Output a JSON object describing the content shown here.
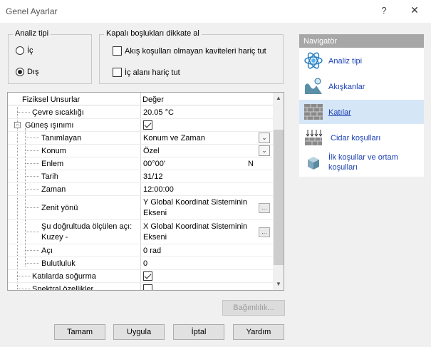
{
  "window": {
    "title": "Genel Ayarlar",
    "help_glyph": "?",
    "close_glyph": "✕"
  },
  "analysis": {
    "legend": "Analiz tipi",
    "options": [
      {
        "label": "İç",
        "selected": false
      },
      {
        "label": "Dış",
        "selected": true
      }
    ]
  },
  "cavities": {
    "legend": "Kapalı boşlukları dikkate al",
    "options": [
      {
        "label": "Akış koşulları olmayan kaviteleri hariç tut",
        "checked": false
      },
      {
        "label": "İç alanı hariç tut",
        "checked": false
      }
    ]
  },
  "grid": {
    "headers": {
      "name": "Fiziksel Unsurlar",
      "value": "Değer"
    },
    "rows": [
      {
        "label": "Çevre sıcaklığı",
        "value": "20.05 °C"
      },
      {
        "label": "Güneş ışınımı",
        "value": "",
        "checked": true
      },
      {
        "label": "Tanımlayan",
        "value": "Konum ve Zaman"
      },
      {
        "label": "Konum",
        "value": "Özel"
      },
      {
        "label": "Enlem",
        "value": "00°00'",
        "suffix": "N"
      },
      {
        "label": "Tarih",
        "value": "31/12"
      },
      {
        "label": "Zaman",
        "value": "12:00:00"
      },
      {
        "label": "Zenit yönü",
        "value_line1": "Y  Global Koordinat Sisteminin",
        "value_line2": "Ekseni"
      },
      {
        "label_line1": "Şu doğrultuda ölçülen açı:",
        "label_line2": "Kuzey -",
        "value_line1": "X  Global Koordinat Sisteminin",
        "value_line2": "Ekseni"
      },
      {
        "label": "Açı",
        "value": "0 rad"
      },
      {
        "label": "Bulutluluk",
        "value": "0"
      },
      {
        "label": "Katılarda soğurma",
        "value": "",
        "checked": true
      },
      {
        "label": "Spektral özellikler",
        "value": "",
        "checked": false
      }
    ],
    "ellipsis": "...",
    "combo_arrow": "⌄",
    "tree_toggle": "−"
  },
  "navigator": {
    "title": "Navigatör",
    "items": [
      {
        "label": "Analiz tipi",
        "icon": "atom-icon"
      },
      {
        "label": "Akışkanlar",
        "icon": "fluid-icon"
      },
      {
        "label": "Katılar",
        "icon": "brick-wall-icon",
        "selected": true
      },
      {
        "label": "Cidar koşulları",
        "icon": "wall-condition-icon"
      },
      {
        "label_line1": "İlk koşullar ve ortam",
        "label_line2": "koşulları",
        "icon": "cube-icon"
      }
    ]
  },
  "buttons": {
    "dependency": "Bağımlılık...",
    "ok": "Tamam",
    "apply": "Uygula",
    "cancel": "İptal",
    "help": "Yardım"
  },
  "colors": {
    "link": "#1a3fb3",
    "nav_header": "#a7a7a7",
    "nav_selected": "#d5e6f7"
  }
}
